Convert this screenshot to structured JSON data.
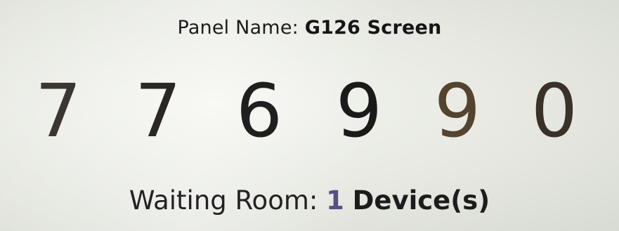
{
  "panel": {
    "label": "Panel Name:",
    "name": "G126 Screen"
  },
  "pairing_code": {
    "digits": [
      "7",
      "7",
      "6",
      "9",
      "9",
      "0"
    ],
    "colors": [
      "#3b3631",
      "#2a2724",
      "#1f1f1f",
      "#1a1a1a",
      "#54442f",
      "#3a3128"
    ]
  },
  "waiting_room": {
    "label": "Waiting Room:",
    "count": "1",
    "unit": "Device(s)",
    "count_color": "#5a4e86"
  }
}
